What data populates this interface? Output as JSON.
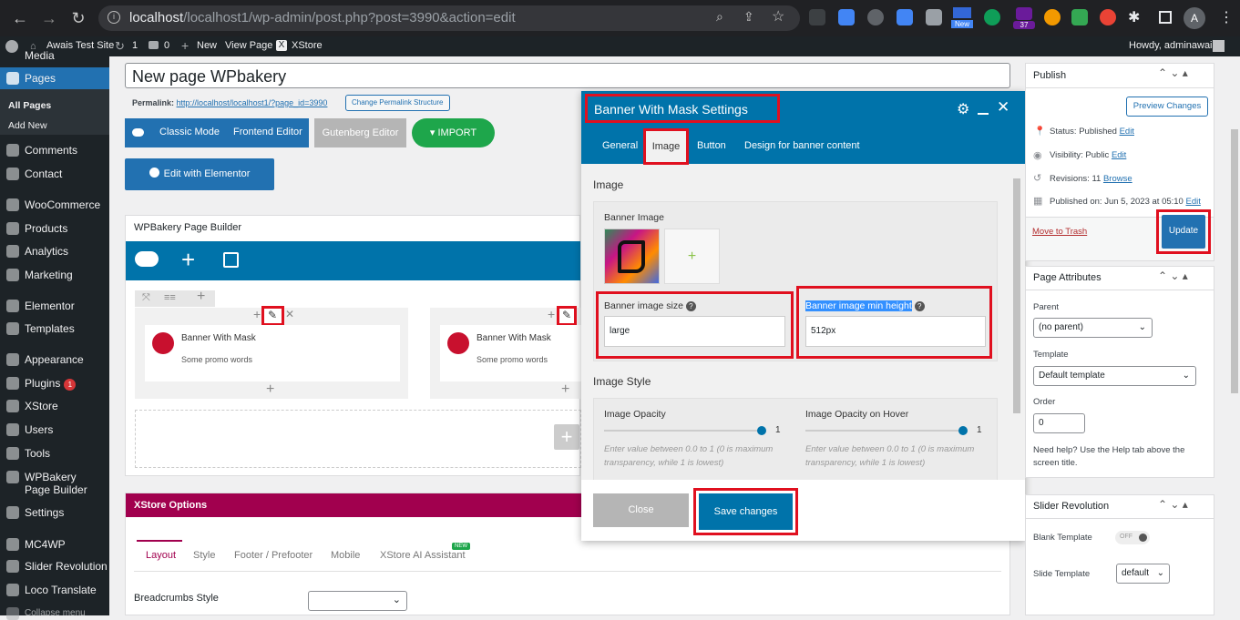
{
  "browser": {
    "url_host": "localhost",
    "url_path": "/localhost1/wp-admin/post.php?post=3990&action=edit",
    "profile_initial": "A",
    "badge_new": "New",
    "badge_count": "37"
  },
  "adminbar": {
    "site": "Awais Test Site",
    "updates": "1",
    "comments": "0",
    "new": "New",
    "view": "View Page",
    "xstore": "XStore",
    "howdy": "Howdy, adminawais"
  },
  "sidebar": {
    "media": "Media",
    "pages": "Pages",
    "all_pages": "All Pages",
    "add_new": "Add New",
    "items": [
      "Comments",
      "Contact",
      "WooCommerce",
      "Products",
      "Analytics",
      "Marketing",
      "Elementor",
      "Templates",
      "Appearance",
      "Plugins",
      "XStore",
      "Users",
      "Tools",
      "WPBakery Page Builder",
      "Settings",
      "MC4WP",
      "Slider Revolution",
      "Loco Translate",
      "Collapse menu"
    ],
    "plugins_badge": "1"
  },
  "editor": {
    "title": "New page WPbakery",
    "permalink_label": "Permalink:",
    "permalink_url": "http://localhost/localhost1/?page_id=3990",
    "permalink_btn": "Change Permalink Structure",
    "classic_mode": "Classic Mode",
    "frontend_editor": "Frontend Editor",
    "gutenberg": "Gutenberg Editor",
    "import": "IMPORT",
    "elementor": "Edit with Elementor",
    "wpb_title": "WPBakery Page Builder",
    "element_name": "Banner With Mask",
    "element_desc": "Some promo words",
    "xstore_options": "XStore Options",
    "xs_tabs": [
      "Layout",
      "Style",
      "Footer / Prefooter",
      "Mobile",
      "XStore AI Assistant"
    ],
    "xs_new": "NEW",
    "breadcrumbs": "Breadcrumbs Style"
  },
  "modal": {
    "title": "Banner With Mask Settings",
    "tabs": [
      "General",
      "Image",
      "Button",
      "Design for banner content"
    ],
    "section_image": "Image",
    "banner_image": "Banner Image",
    "size_label": "Banner image size",
    "size_value": "large",
    "height_label": "Banner image min height",
    "height_value": "512px",
    "section_style": "Image Style",
    "opacity": "Image Opacity",
    "opacity_hover": "Image Opacity on Hover",
    "opacity_value": "1",
    "opacity_hover_value": "1",
    "hint": "Enter value between 0.0 to 1 (0 is maximum transparency, while 1 is lowest)",
    "close": "Close",
    "save": "Save changes"
  },
  "publish": {
    "title": "Publish",
    "preview": "Preview Changes",
    "status": "Status: Published",
    "visibility": "Visibility: Public",
    "revisions": "Revisions: 11",
    "browse": "Browse",
    "published_on": "Published on: Jun 5, 2023 at 05:10",
    "edit": "Edit",
    "trash": "Move to Trash",
    "update": "Update"
  },
  "attributes": {
    "title": "Page Attributes",
    "parent": "Parent",
    "parent_value": "(no parent)",
    "template": "Template",
    "template_value": "Default template",
    "order": "Order",
    "order_value": "0",
    "help": "Need help? Use the Help tab above the screen title."
  },
  "slider": {
    "title": "Slider Revolution",
    "blank": "Blank Template",
    "off": "OFF",
    "slide_template": "Slide Template",
    "slide_value": "default"
  },
  "colors": {
    "wp_blue": "#2271b1",
    "modal_blue": "#0073aa",
    "highlight_red": "#e0101f",
    "import_green": "#1ea64b",
    "xstore_magenta": "#a1004e"
  }
}
